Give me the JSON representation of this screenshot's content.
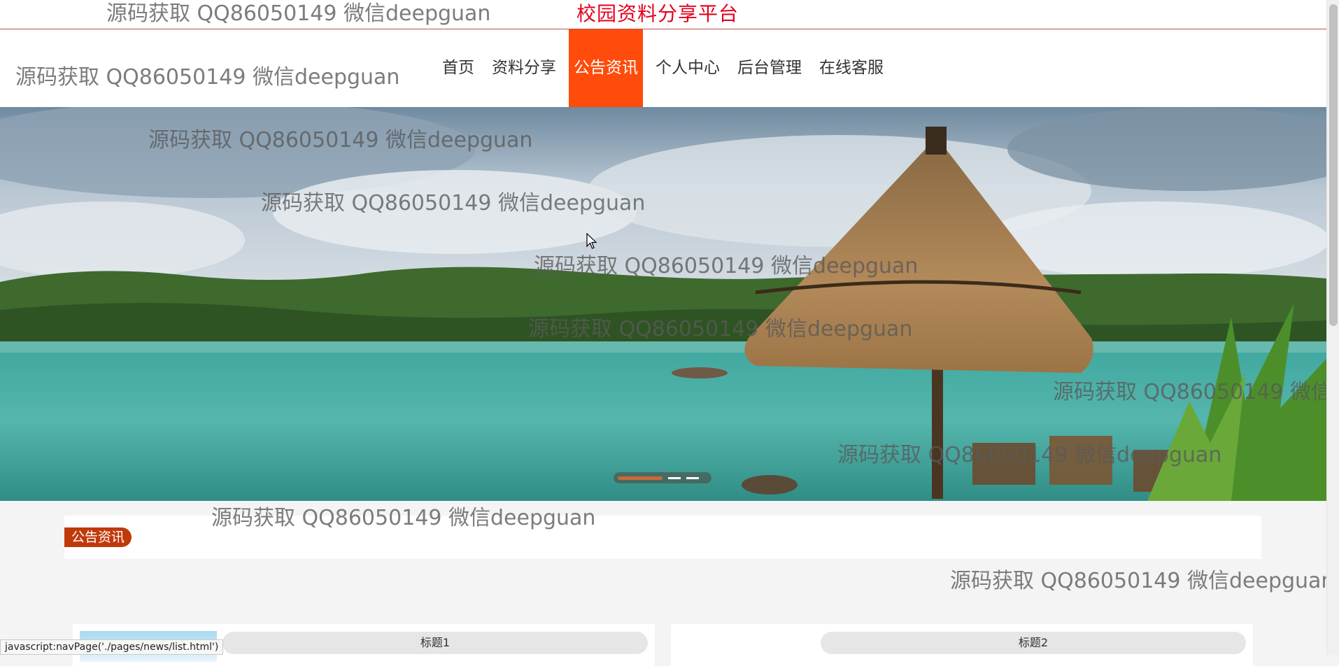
{
  "site": {
    "title": "校园资料分享平台"
  },
  "nav": {
    "items": [
      {
        "label": "首页",
        "active": false
      },
      {
        "label": "资料分享",
        "active": false
      },
      {
        "label": "公告资讯",
        "active": true
      },
      {
        "label": "个人中心",
        "active": false
      },
      {
        "label": "后台管理",
        "active": false
      },
      {
        "label": "在线客服",
        "active": false
      }
    ]
  },
  "banner": {
    "slide_count": 3,
    "active_slide": 1
  },
  "section": {
    "label": "公告资讯"
  },
  "cards": [
    {
      "title": "标题1"
    },
    {
      "title": "标题2"
    }
  ],
  "watermark": "源码获取 QQ86050149 微信deepguan",
  "statusbar": {
    "text": "javascript:navPage('./pages/news/list.html')"
  },
  "colors": {
    "accent": "#ff4b0c",
    "title_red": "#e5001e",
    "badge": "#c0390b"
  },
  "icons": {
    "cursor": "arrow-cursor-icon"
  }
}
